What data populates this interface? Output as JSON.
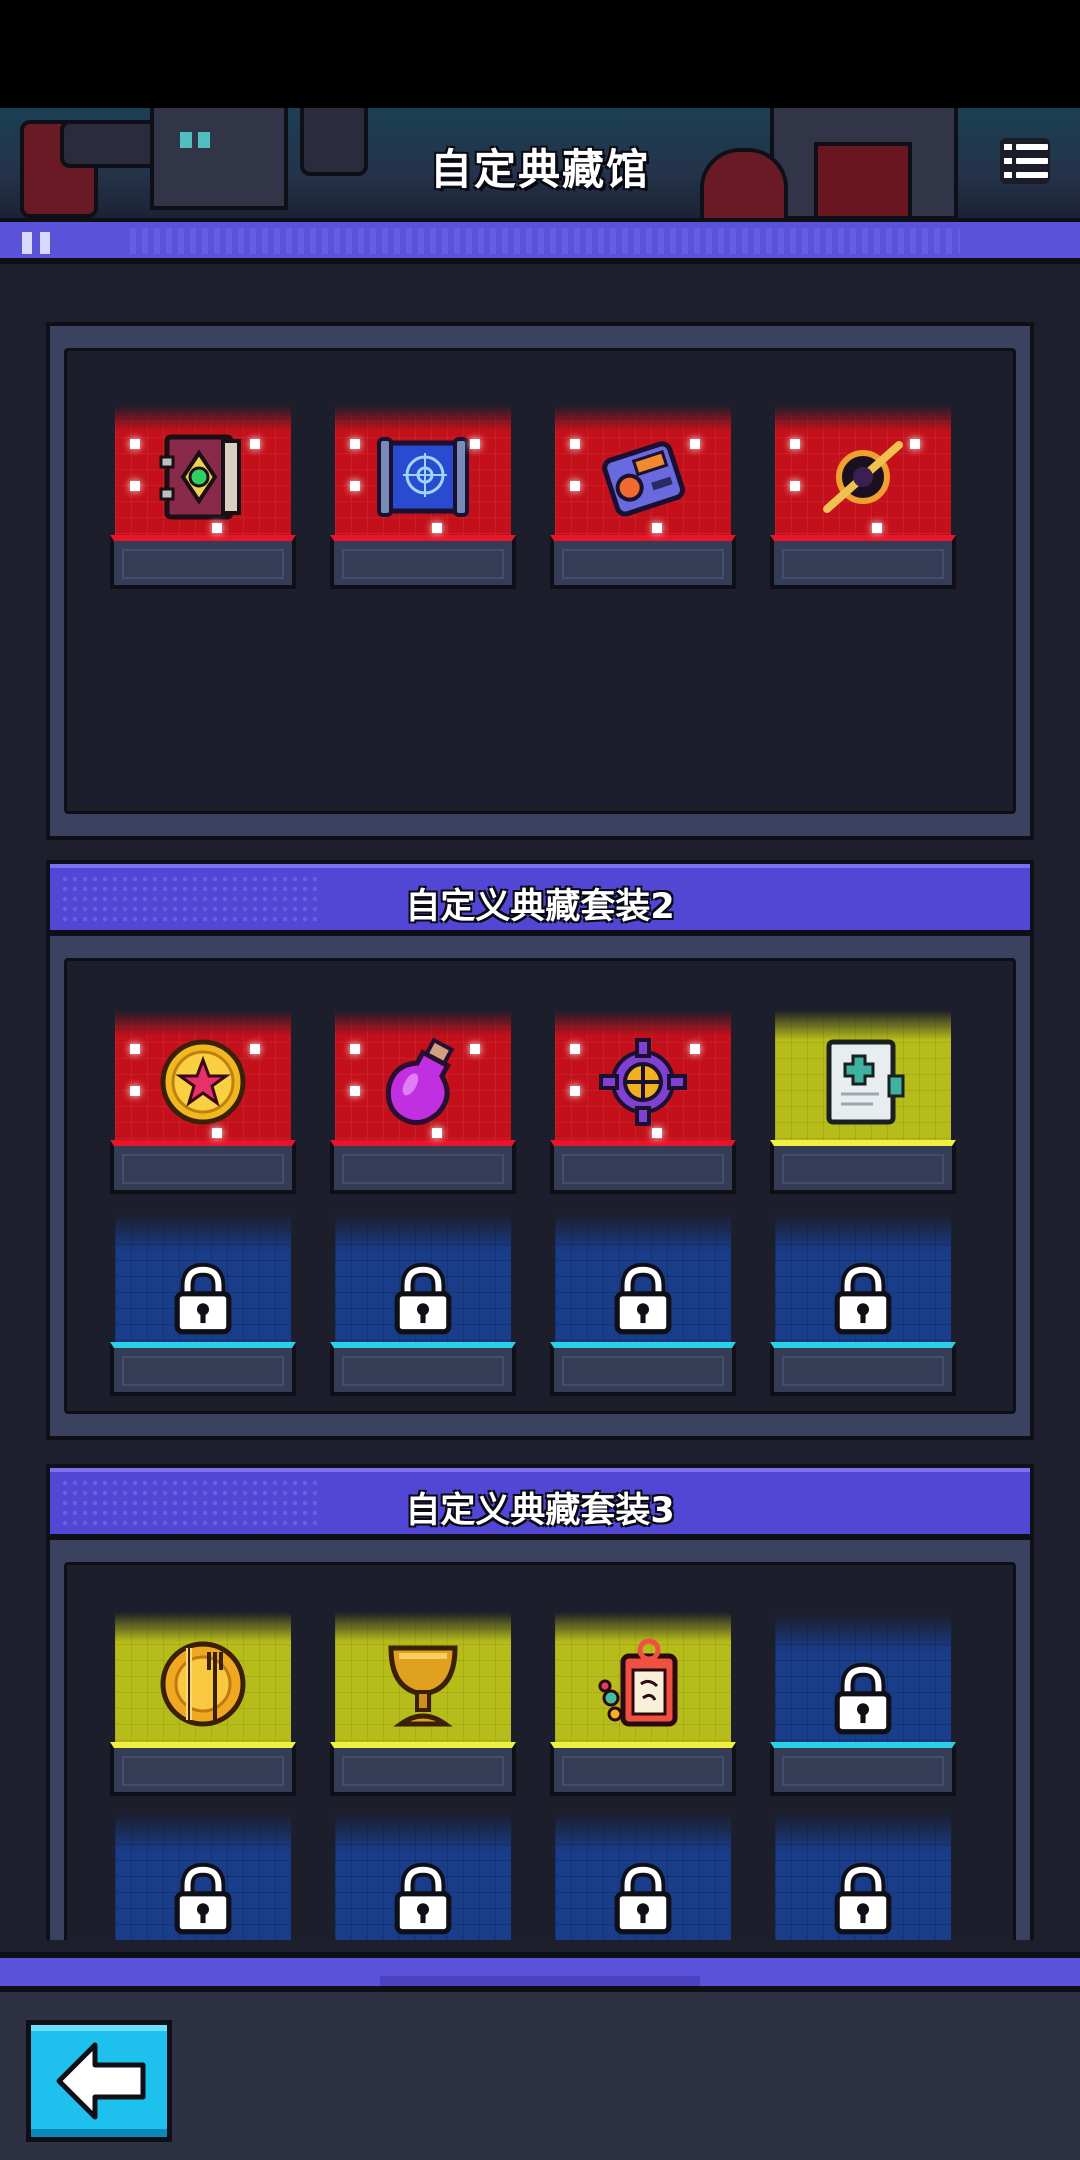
{
  "header": {
    "title": "自定典藏馆"
  },
  "sets": [
    {
      "title": "",
      "items": [
        {
          "name": "magic-tome-icon",
          "rarity": "red",
          "locked": false
        },
        {
          "name": "blueprint-scroll-icon",
          "rarity": "red",
          "locked": false
        },
        {
          "name": "remote-device-icon",
          "rarity": "red",
          "locked": false
        },
        {
          "name": "black-hole-ring-icon",
          "rarity": "red",
          "locked": false
        }
      ]
    },
    {
      "title": "自定义典藏套装2",
      "items": [
        {
          "name": "star-coin-icon",
          "rarity": "red",
          "locked": false
        },
        {
          "name": "purple-potion-icon",
          "rarity": "red",
          "locked": false
        },
        {
          "name": "purple-gear-icon",
          "rarity": "red",
          "locked": false
        },
        {
          "name": "medical-book-icon",
          "rarity": "yellow",
          "locked": false
        },
        {
          "name": "lock-icon",
          "rarity": "blue",
          "locked": true
        },
        {
          "name": "lock-icon",
          "rarity": "blue",
          "locked": true
        },
        {
          "name": "lock-icon",
          "rarity": "blue",
          "locked": true
        },
        {
          "name": "lock-icon",
          "rarity": "blue",
          "locked": true
        }
      ]
    },
    {
      "title": "自定义典藏套装3",
      "items": [
        {
          "name": "plate-cutlery-icon",
          "rarity": "yellow",
          "locked": false
        },
        {
          "name": "golden-chalice-icon",
          "rarity": "yellow",
          "locked": false
        },
        {
          "name": "gift-tag-icon",
          "rarity": "yellow",
          "locked": false
        },
        {
          "name": "lock-icon",
          "rarity": "blue",
          "locked": true
        },
        {
          "name": "lock-icon",
          "rarity": "blue",
          "locked": true
        },
        {
          "name": "lock-icon",
          "rarity": "blue",
          "locked": true
        },
        {
          "name": "lock-icon",
          "rarity": "blue",
          "locked": true
        },
        {
          "name": "lock-icon",
          "rarity": "blue",
          "locked": true
        }
      ]
    }
  ],
  "colors": {
    "rarity_red": "#c4101a",
    "rarity_yellow": "#b6bc1a",
    "locked_blue": "#1a3d8a",
    "header_purple": "#5246d4",
    "back_button": "#1ec0ee"
  },
  "footer": {
    "back_icon": "back-arrow-icon"
  }
}
